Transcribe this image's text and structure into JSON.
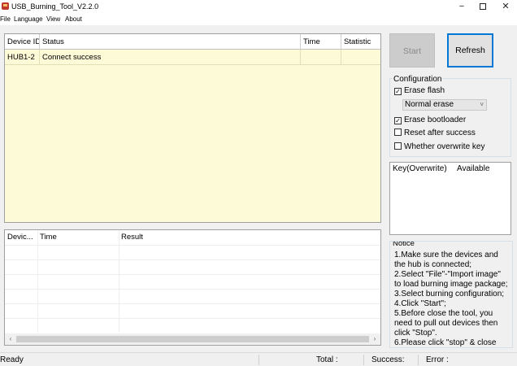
{
  "window": {
    "title": "USB_Burning_Tool_V2.2.0",
    "minimize_glyph": "−",
    "close_glyph": "✕"
  },
  "menu": [
    "File",
    "Language",
    "View",
    "About"
  ],
  "device_table": {
    "columns": [
      "Device ID",
      "Status",
      "Time",
      "Statistic"
    ],
    "rows": [
      {
        "device_id": "HUB1-2",
        "status": "Connect success",
        "time": "",
        "statistic": ""
      }
    ]
  },
  "log_table": {
    "columns": [
      "Devic...",
      "Time",
      "Result"
    ],
    "scroll_left": "‹",
    "scroll_right": "›"
  },
  "buttons": {
    "start": "Start",
    "refresh": "Refresh"
  },
  "configuration": {
    "label": "Configuration",
    "erase_flash": {
      "label": "Erase flash",
      "checked": true
    },
    "erase_mode": "Normal erase",
    "erase_bootloader": {
      "label": "Erase bootloader",
      "checked": true
    },
    "reset_after_success": {
      "label": "Reset after success",
      "checked": false
    },
    "overwrite_key": {
      "label": "Whether overwrite key",
      "checked": false
    },
    "check_glyph": "✓",
    "chevron_glyph": "˅"
  },
  "key_list": {
    "columns": [
      "Key(Overwrite)",
      "Available"
    ]
  },
  "notice": {
    "label": "Notice",
    "lines": [
      "1.Make sure the devices and",
      "the hub is connected;",
      "2.Select \"File\"-\"Import image\"",
      "to load burning image package;",
      "3.Select burning configuration;",
      "4.Click \"Start\";",
      "5.Before close the tool, you",
      "need to pull out devices then",
      "click \"Stop\".",
      "6.Please click \"stop\" & close"
    ]
  },
  "status_bar": {
    "state": "Ready",
    "total_label": "Total :",
    "success_label": "Success:",
    "error_label": "Error :"
  },
  "colors": {
    "device_table_bg": "#fdfad8",
    "refresh_focus_border": "#0078d7",
    "disabled_button_bg": "#cccccc"
  }
}
